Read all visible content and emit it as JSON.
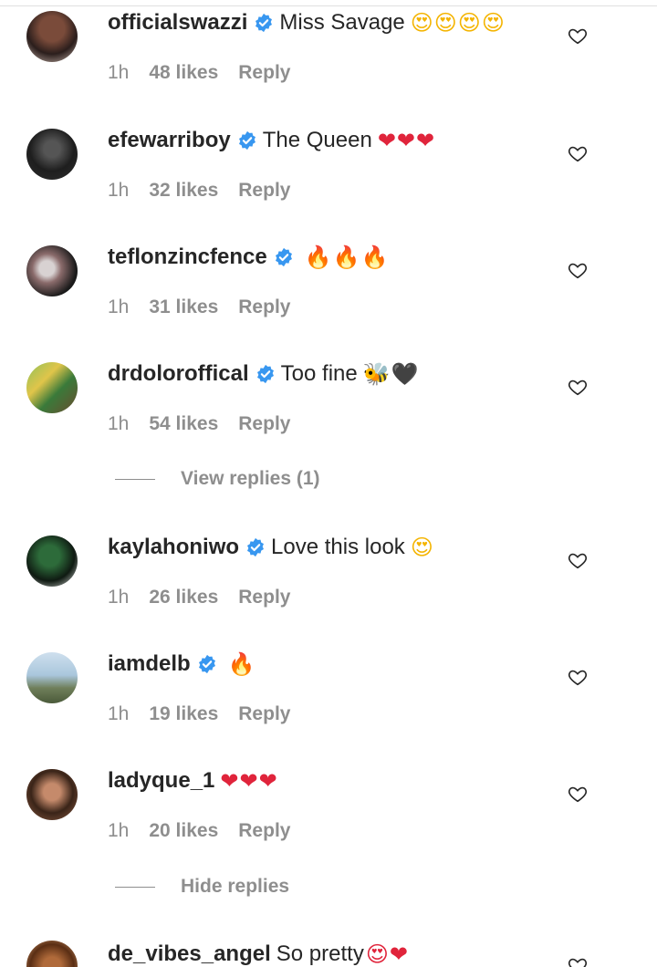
{
  "comments": [
    {
      "username": "officialswazzi",
      "verified": true,
      "text": "Miss Savage",
      "emoji": "😍😍😍😍",
      "time": "1h",
      "likes": "48 likes",
      "reply": "Reply"
    },
    {
      "username": "efewarriboy",
      "verified": true,
      "text": "The Queen",
      "emoji": "❤❤❤",
      "time": "1h",
      "likes": "32 likes",
      "reply": "Reply"
    },
    {
      "username": "teflonzincfence",
      "verified": true,
      "text": "",
      "emoji": "🔥🔥🔥",
      "time": "1h",
      "likes": "31 likes",
      "reply": "Reply"
    },
    {
      "username": "drdoloroffical",
      "verified": true,
      "text": "Too fine",
      "emoji": "🐝🖤",
      "time": "1h",
      "likes": "54 likes",
      "reply": "Reply"
    },
    {
      "username": "kaylahoniwo",
      "verified": true,
      "text": "Love this look",
      "emoji": "😍",
      "time": "1h",
      "likes": "26 likes",
      "reply": "Reply"
    },
    {
      "username": "iamdelb",
      "verified": true,
      "text": "",
      "emoji": "🔥",
      "time": "1h",
      "likes": "19 likes",
      "reply": "Reply"
    },
    {
      "username": "ladyque_1",
      "verified": false,
      "text": "",
      "emoji": "❤❤❤",
      "time": "1h",
      "likes": "20 likes",
      "reply": "Reply"
    },
    {
      "username": "de_vibes_angel",
      "verified": false,
      "text": "So pretty",
      "emoji": "😍❤",
      "time": "",
      "likes": "",
      "reply": ""
    }
  ],
  "view_replies": "View replies (1)",
  "hide_replies": "Hide replies",
  "colors": {
    "verified": "#3897f0",
    "muted": "#8e8e8e",
    "text": "#262626"
  }
}
